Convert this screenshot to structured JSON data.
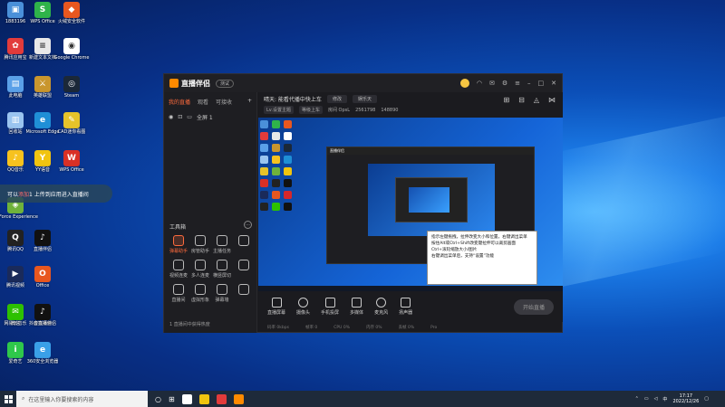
{
  "desktop": {
    "icons": [
      {
        "label": "1883196",
        "color": "#4a90d9",
        "glyph": "▣"
      },
      {
        "label": "WPS Office",
        "color": "#2fb34a",
        "glyph": "S"
      },
      {
        "label": "火绒安全软件",
        "color": "#e8571f",
        "glyph": "◆"
      },
      {
        "label": "腾讯应用宝",
        "color": "#e23b3b",
        "glyph": "✿"
      },
      {
        "label": "新建文本文档",
        "color": "#e8e8e8",
        "glyph": "≡"
      },
      {
        "label": "Google Chrome",
        "color": "#ffffff",
        "glyph": "◉"
      },
      {
        "label": "此电脑",
        "color": "#5aa0e8",
        "glyph": "▤"
      },
      {
        "label": "英雄联盟",
        "color": "#c9962e",
        "glyph": "⚔"
      },
      {
        "label": "Steam",
        "color": "#1b2838",
        "glyph": "◎"
      },
      {
        "label": "回收站",
        "color": "#9ac4f0",
        "glyph": "▥"
      },
      {
        "label": "QQ音乐",
        "color": "#f7c21e",
        "glyph": "♪"
      },
      {
        "label": "Microsoft Edge",
        "color": "#1f8fd6",
        "glyph": "e"
      },
      {
        "label": "CAD迷你看图",
        "color": "#e6c32a",
        "glyph": "✎"
      },
      {
        "label": "GeForce Experience",
        "color": "#6fb23b",
        "glyph": "◈"
      },
      {
        "label": "YY语音",
        "color": "#f1c40f",
        "glyph": "Y"
      },
      {
        "label": "WPS Office",
        "color": "#d93025",
        "glyph": "W"
      },
      {
        "label": "腾讯QQ",
        "color": "#222",
        "glyph": "Q"
      },
      {
        "label": "直播伴侣",
        "color": "#111",
        "glyph": "♪"
      },
      {
        "label": "腾讯视频",
        "color": "#1a2a5a",
        "glyph": "▶"
      },
      {
        "label": "Office",
        "color": "#e8571f",
        "glyph": "O"
      },
      {
        "label": "网易云音乐",
        "color": "#d6272b",
        "glyph": "◉"
      },
      {
        "label": "虚拟桌面",
        "color": "#222",
        "glyph": "⌂"
      },
      {
        "label": "微信",
        "color": "#2dc100",
        "glyph": "✉"
      },
      {
        "label": "抖音直播伴侣",
        "color": "#111",
        "glyph": "♪"
      },
      {
        "label": "爱奇艺",
        "color": "#2fc84b",
        "glyph": "i"
      },
      {
        "label": "360安全浏览器",
        "color": "#3aa0e8",
        "glyph": "e"
      }
    ],
    "notice": {
      "prefix": "可以",
      "highlight": "添加",
      "suffix": "1 上传到应用进入直播间"
    }
  },
  "app": {
    "name": "直播伴侣",
    "version": "测试",
    "left_tabs": [
      "我的直播",
      "观看",
      "可接收"
    ],
    "scene_label": "全屏 1",
    "tools_title": "工具箱",
    "tools": [
      {
        "label": "弹幕助手",
        "hot": true
      },
      {
        "label": "房管助手",
        "hot": false
      },
      {
        "label": "主播任务",
        "hot": false
      },
      {
        "label": "",
        "hot": false
      },
      {
        "label": "视频连麦",
        "hot": false
      },
      {
        "label": "多人连麦",
        "hot": false
      },
      {
        "label": "横竖屏切",
        "hot": false
      },
      {
        "label": "",
        "hot": false
      },
      {
        "label": "直播间",
        "hot": false
      },
      {
        "label": "虚拟形象",
        "hot": false
      },
      {
        "label": "弹幕墙",
        "hot": false
      },
      {
        "label": "",
        "hot": false
      }
    ],
    "left_footer": "1 直播间中获得热度",
    "live_title": "晴天: 能看代播中快上车",
    "edit_label": "修改",
    "category_label": "娱乐天",
    "tags": [
      "Lv.设置主题",
      "等级上车"
    ],
    "stats": [
      "房间 OpsL",
      "2561798",
      "148890"
    ],
    "tooltip_lines": [
      "指示左键拖拽，拉伸改变大小和位置，右键调出菜单",
      "按住Alt或Ctrl+Shift改变键拉伸可以裁剪画面",
      "Ctrl+滚轮缩放大小/图片",
      "右键调出菜单后，支持“设置”功能"
    ],
    "bottom_tools": [
      {
        "label": "直播屏幕",
        "round": false
      },
      {
        "label": "摄像头",
        "round": true
      },
      {
        "label": "手机投屏",
        "round": false
      },
      {
        "label": "多媒体",
        "round": false
      },
      {
        "label": "麦克风",
        "round": true
      },
      {
        "label": "扬声器",
        "round": false
      }
    ],
    "go_live_label": "开始直播",
    "status_items": [
      "码率 0kbps",
      "帧率 0",
      "CPU 0%",
      "内存 0%",
      "丢帧 0%",
      "Pro"
    ]
  },
  "taskbar": {
    "search_placeholder": "在这里输入你要搜索的内容",
    "time": "17:17",
    "date": "2022/12/26",
    "apps": [
      "#ffffff",
      "#f1c40f",
      "#e23b3b",
      "#ff8a00"
    ]
  }
}
